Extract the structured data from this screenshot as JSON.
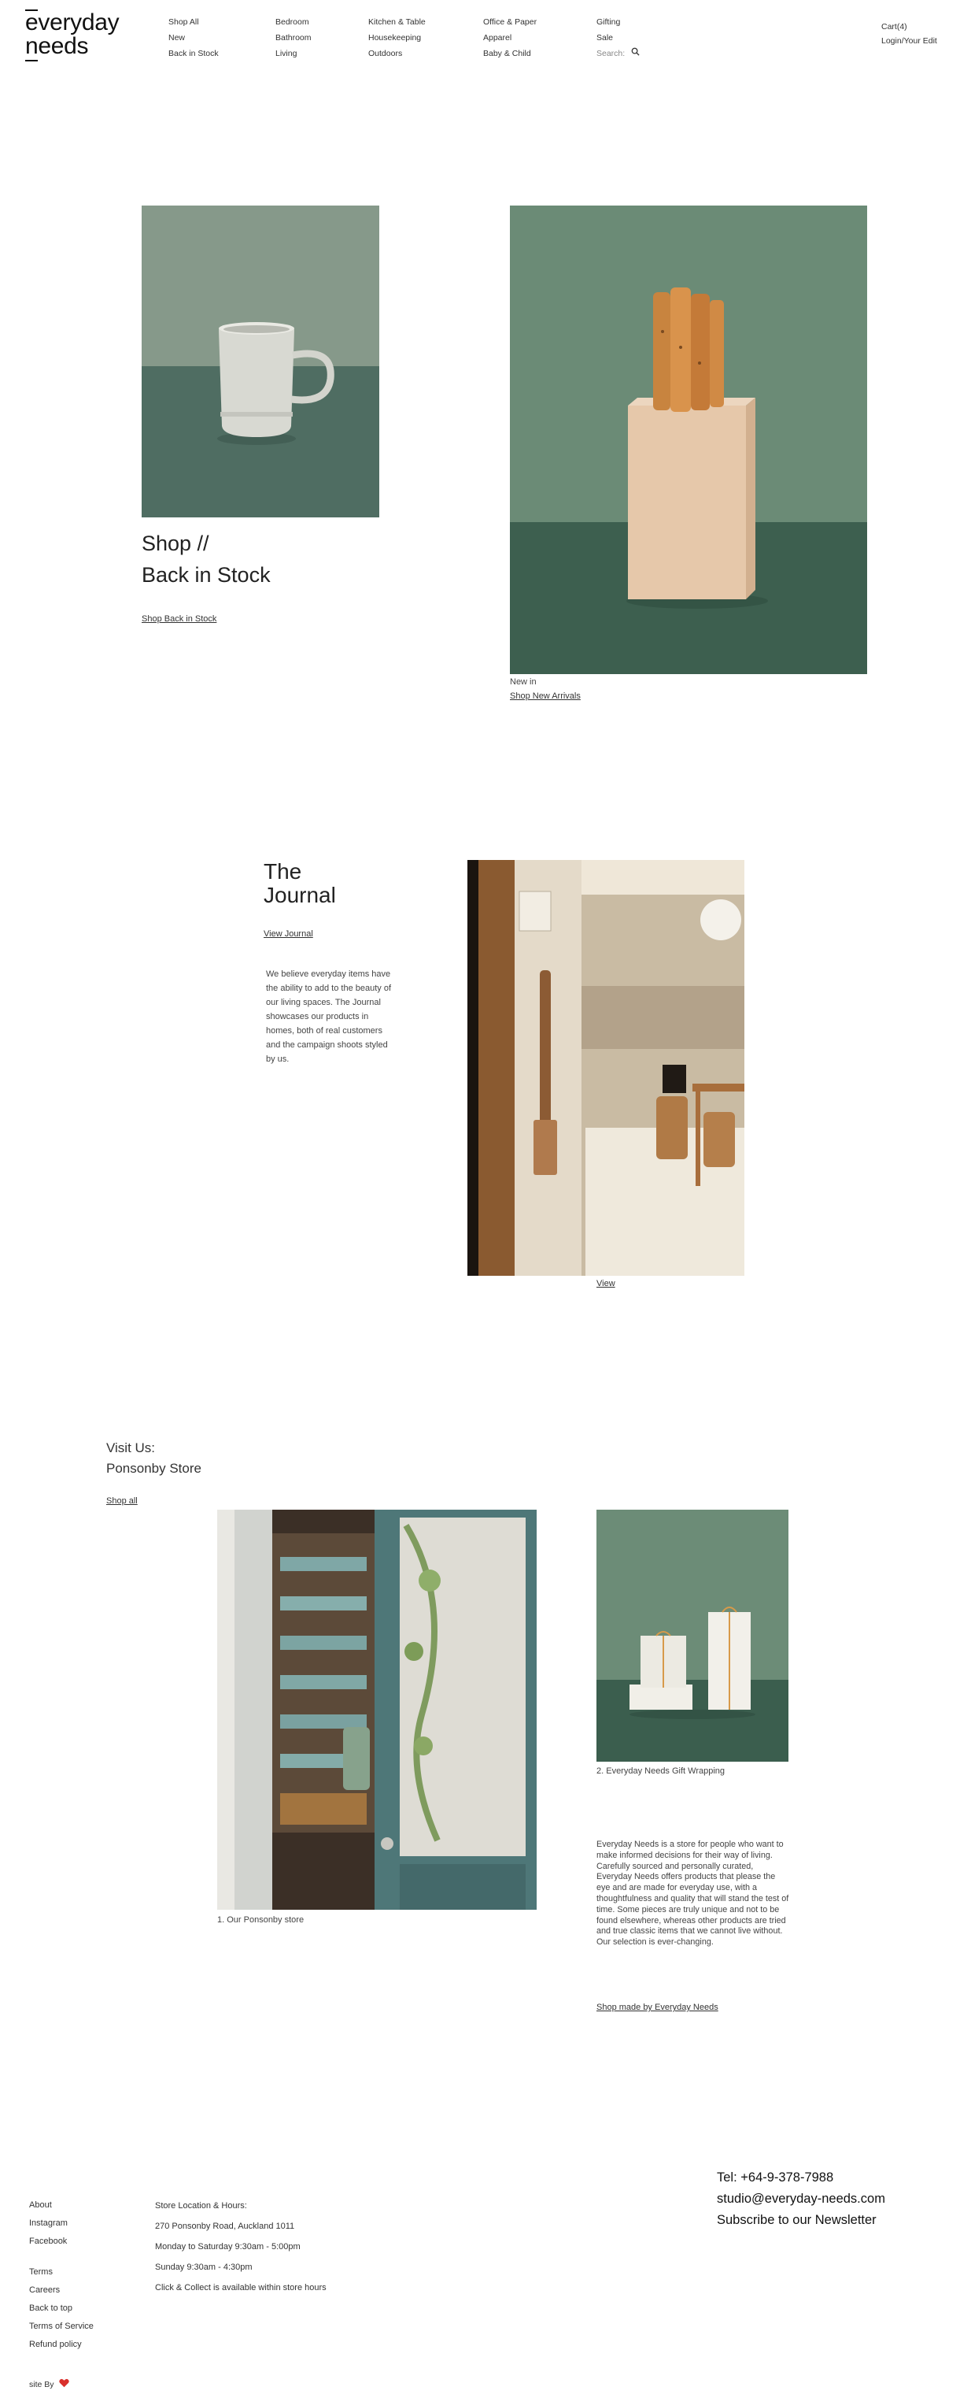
{
  "brand": {
    "line1": "everyday",
    "line2": "needs"
  },
  "nav": {
    "col1": [
      "Shop All",
      "New",
      "Back in Stock"
    ],
    "col2": [
      "Bedroom",
      "Bathroom",
      "Living"
    ],
    "col3": [
      "Kitchen & Table",
      "Housekeeping",
      "Outdoors"
    ],
    "col4": [
      "Office & Paper",
      "Apparel",
      "Baby & Child"
    ],
    "col5": [
      "Gifting",
      "Sale"
    ],
    "search_placeholder": "Search:",
    "cart": "Cart(4)",
    "login": "Login/Your Edit"
  },
  "hero": {
    "shop_title_1": "Shop //",
    "shop_title_2": "Back in Stock",
    "shop_link": "Shop Back in Stock",
    "new_in": "New in",
    "new_link": "Shop New Arrivals"
  },
  "journal": {
    "title_1": "The",
    "title_2": "Journal",
    "link": "View Journal",
    "body": "We believe everyday items have the ability to add to the beauty of our living spaces. The Journal showcases our products in homes, both of real customers and the campaign shoots styled by us.",
    "view": "View"
  },
  "visit": {
    "title_1": "Visit Us:",
    "title_2": "Ponsonby Store",
    "shop_all": "Shop all",
    "cap1": "1. Our Ponsonby store",
    "cap2": "2. Everyday Needs Gift Wrapping",
    "about": "Everyday Needs is a store for people who want to make informed decisions for their way of living. Carefully sourced and personally curated, Everyday Needs offers products that please the eye and are made for everyday use, with a thoughtfulness and quality that will stand the test of time. Some pieces are truly unique and not to be found elsewhere, whereas other products are tried and true classic items that we cannot live without. Our selection is ever-changing.",
    "made_link": "Shop made by Everyday Needs"
  },
  "footer": {
    "links1": [
      "About",
      "Instagram",
      "Facebook"
    ],
    "links2": [
      "Terms",
      "Careers",
      "Back to top",
      "Terms of Service",
      "Refund policy"
    ],
    "info": [
      "Store Location & Hours:",
      "270 Ponsonby Road, Auckland 1011",
      "Monday to Saturday 9:30am - 5:00pm",
      "Sunday 9:30am - 4:30pm",
      "Click & Collect is available within store hours"
    ],
    "tel": "Tel: +64-9-378-7988",
    "email": "studio@everyday-needs.com",
    "newsletter": "Subscribe to our Newsletter",
    "site_by": "site By"
  },
  "colors": {
    "sage": "#8a9b88",
    "dark_green": "#4b6a5a",
    "heart": "#d9302c"
  }
}
